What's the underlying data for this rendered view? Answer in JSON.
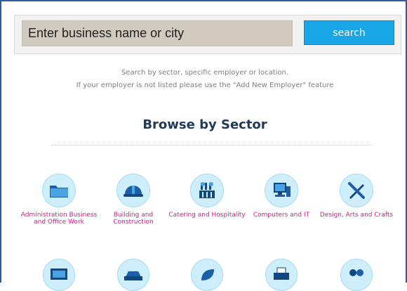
{
  "search": {
    "placeholder": "Enter business name or city",
    "button_label": "search"
  },
  "help": {
    "line1": "Search by sector, specific employer or location.",
    "line2": "If your employer is not listed please use the \"Add New Employer\" feature"
  },
  "section_title": "Browse by Sector",
  "colors": {
    "accent": "#18a6e6",
    "title": "#1f3a5b",
    "sector_label": "#d6198c",
    "icon_circle": "#cdeefa"
  },
  "sectors": [
    {
      "label": "Administration Business and Office Work",
      "icon": "folder-icon"
    },
    {
      "label": "Building and Construction",
      "icon": "hard-hat-icon"
    },
    {
      "label": "Catering and Hospitality",
      "icon": "kitchen-utensils-icon"
    },
    {
      "label": "Computers and IT",
      "icon": "computer-icon"
    },
    {
      "label": "Design, Arts and Crafts",
      "icon": "pencil-ruler-icon"
    }
  ],
  "sectors_row2_icons": [
    "monitor-icon",
    "car-icon",
    "leaf-icon",
    "printer-icon",
    "people-icon"
  ]
}
